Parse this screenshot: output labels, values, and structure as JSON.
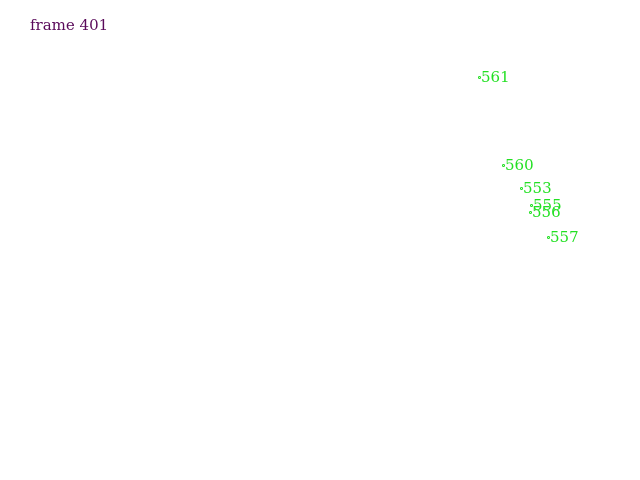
{
  "frame": {
    "label": "frame 401",
    "color": "#5a0a5a"
  },
  "tracks": {
    "color": "#22e022",
    "icon": "point-marker",
    "items": [
      {
        "id": "561",
        "label": "561"
      },
      {
        "id": "560",
        "label": "560"
      },
      {
        "id": "553",
        "label": "553"
      },
      {
        "id": "555",
        "label": "555"
      },
      {
        "id": "556",
        "label": "556"
      },
      {
        "id": "557",
        "label": "557"
      }
    ]
  }
}
